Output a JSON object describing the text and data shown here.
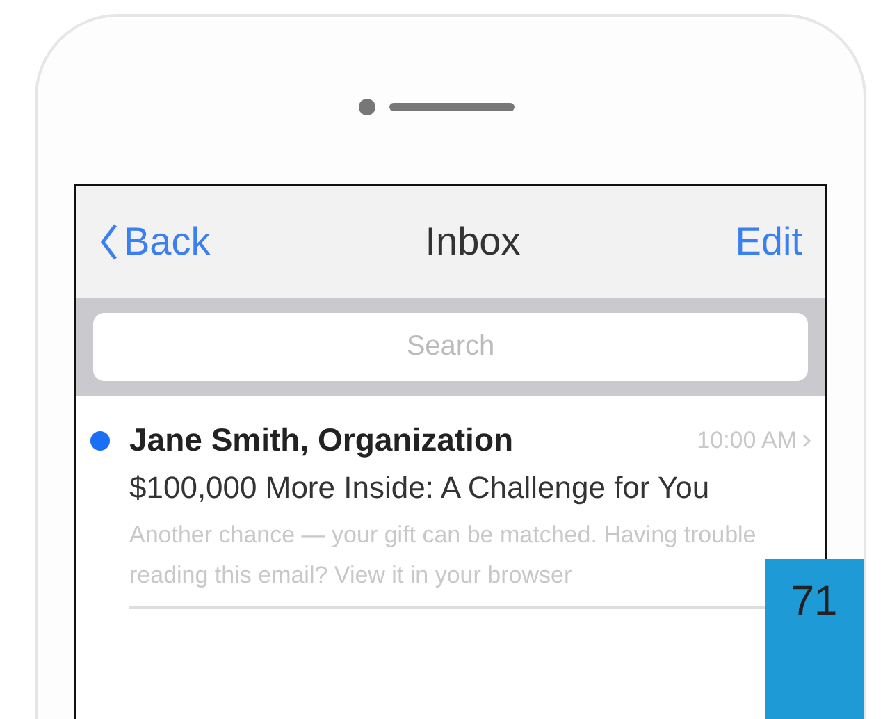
{
  "nav_bar": {
    "back": "Back",
    "title": "Inbox",
    "edit": "Edit"
  },
  "search": {
    "placeholder": "Search"
  },
  "messages": [
    {
      "sender": "Jane Smith, Organization",
      "time": "10:00 AM",
      "subject": "$100,000 More Inside: A Challenge for You",
      "preview": "Another chance — your gift can be matched. Having trouble reading this email? View it in your browser",
      "unread": true
    }
  ],
  "page_badge": "71"
}
